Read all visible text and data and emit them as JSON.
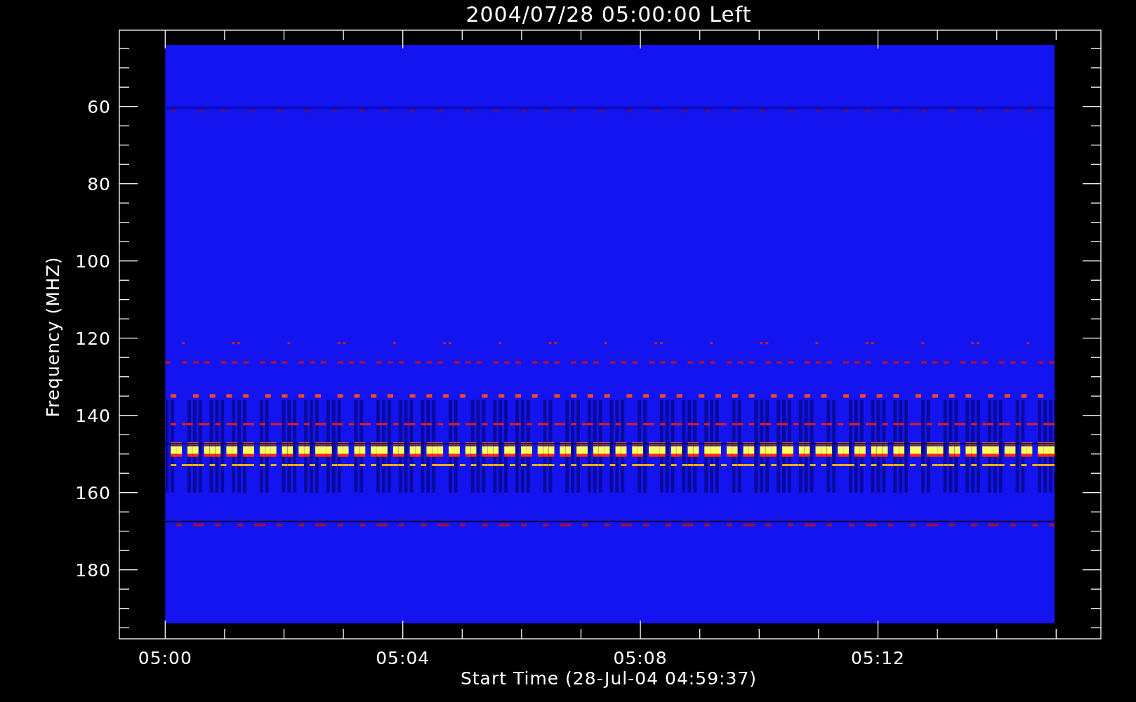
{
  "title": "2004/07/28 05:00:00 Left",
  "plot": {
    "ylabel": "Frequency (MHZ)",
    "xlabel": "Start Time (28-Jul-04 04:59:37)",
    "yticks": [
      "60",
      "80",
      "100",
      "120",
      "140",
      "160",
      "180"
    ],
    "xticks": [
      "05:00",
      "05:04",
      "05:08",
      "05:12"
    ]
  }
}
